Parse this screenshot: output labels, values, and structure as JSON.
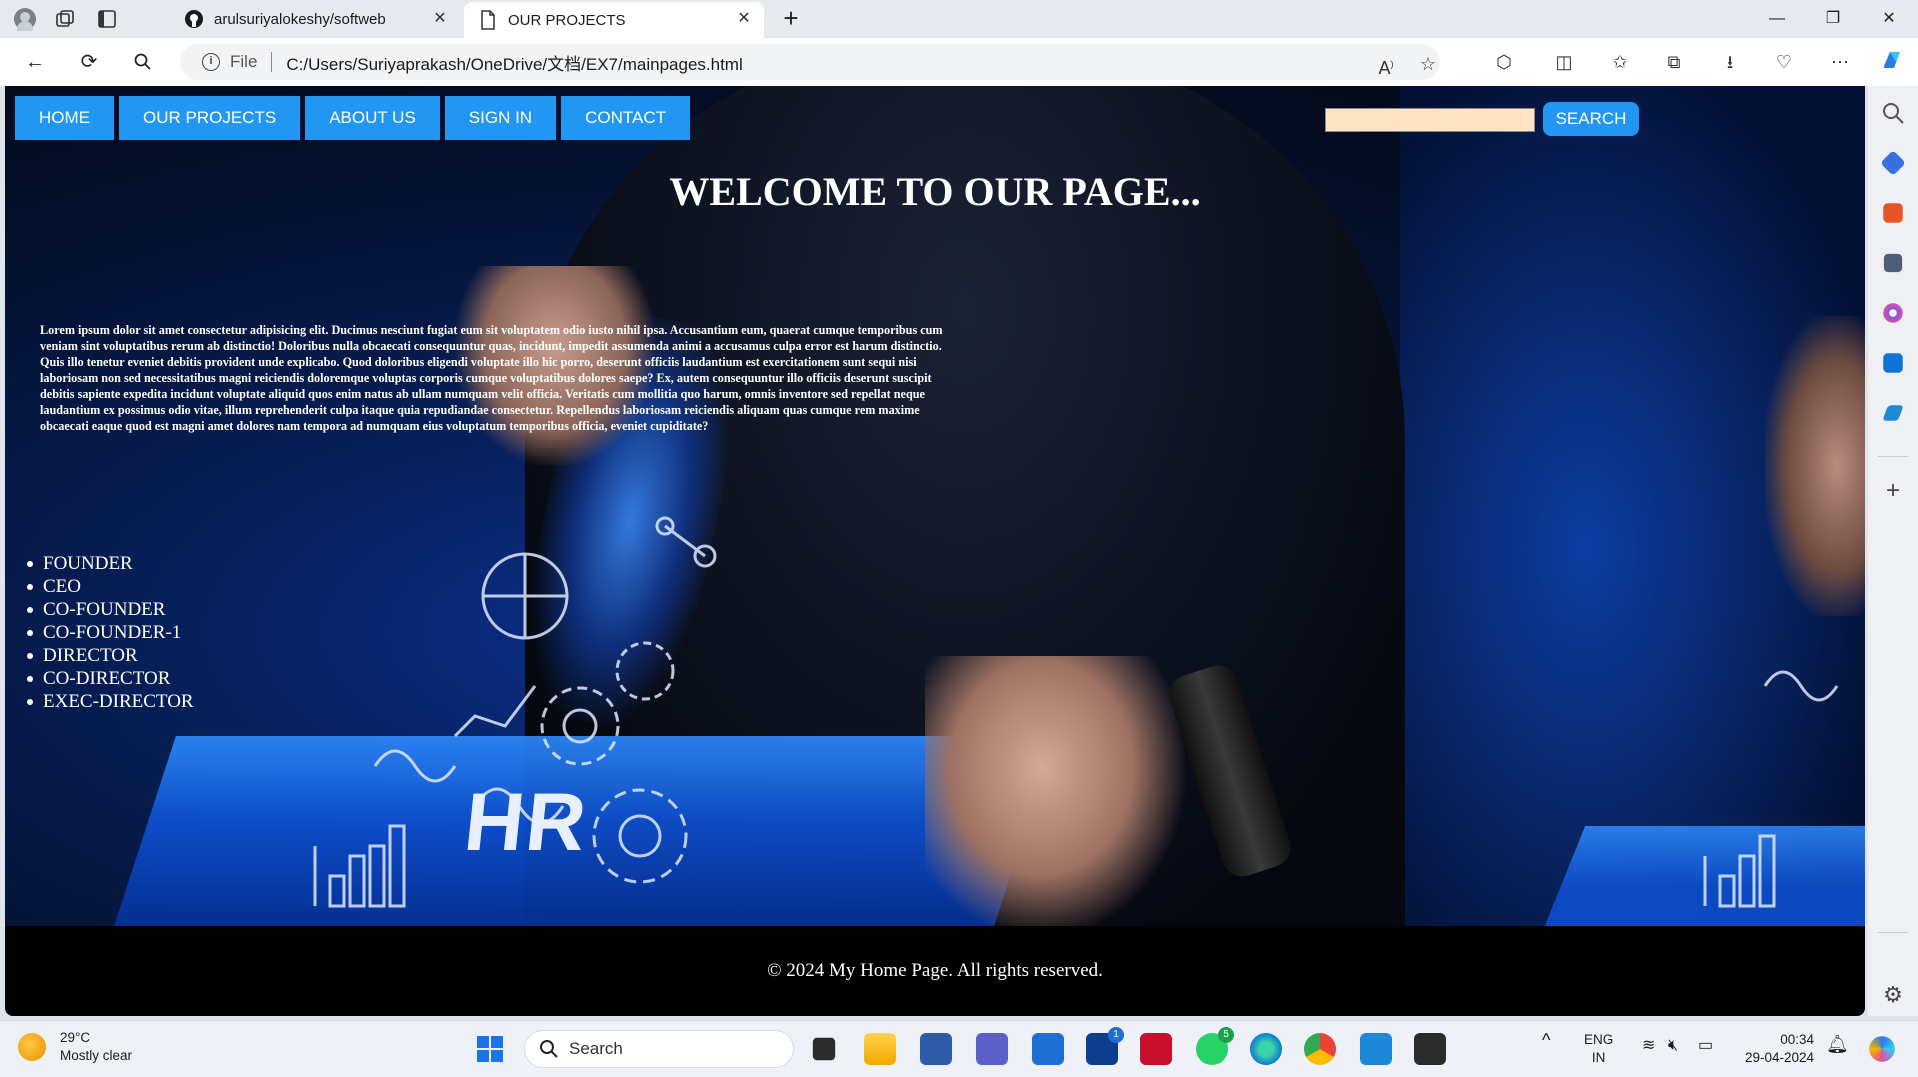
{
  "browser": {
    "tabs": [
      {
        "title": "arulsuriyalokeshy/softweb",
        "active": false
      },
      {
        "title": "OUR PROJECTS",
        "active": true
      }
    ],
    "address": {
      "scheme_label": "File",
      "url": "C:/Users/Suriyaprakash/OneDrive/文档/EX7/mainpages.html"
    },
    "window_controls": {
      "minimize": "—",
      "restore": "❐",
      "close": "✕"
    },
    "new_tab": "+"
  },
  "page": {
    "nav": {
      "items": [
        "HOME",
        "OUR PROJECTS",
        "ABOUT US",
        "SIGN IN",
        "CONTACT"
      ],
      "color": "#2196f3"
    },
    "search": {
      "value": "",
      "button": "SEARCH",
      "field_color": "#ffe4c4"
    },
    "heading": "WELCOME TO OUR PAGE...",
    "lorem": "Lorem ipsum dolor sit amet consectetur adipisicing elit. Ducimus nesciunt fugiat eum sit voluptatem odio iusto nihil ipsa. Accusantium eum, quaerat cumque temporibus cum veniam sint voluptatibus rerum ab distinctio! Doloribus nulla obcaecati consequuntur quas, incidunt, impedit assumenda animi a accusamus culpa error est harum distinctio. Quis illo tenetur eveniet debitis provident unde explicabo. Quod doloribus eligendi voluptate illo hic porro, deserunt officiis laudantium est exercitationem sunt sequi nisi laboriosam non sed necessitatibus magni reiciendis doloremque voluptas corporis cumque voluptatibus dolores saepe? Ex, autem consequuntur illo officiis deserunt suscipit debitis sapiente expedita incidunt voluptate aliquid quos enim natus ab ullam numquam velit officia. Veritatis cum mollitia quo harum, omnis inventore sed repellat neque laudantium ex possimus odio vitae, illum reprehenderit culpa itaque quia repudiandae consectetur. Repellendus laboriosam reiciendis aliquam quas cumque rem maxime obcaecati eaque quod est magni amet dolores nam tempora ad numquam eius voluptatum temporibus officia, eveniet cupiditate?",
    "roles": [
      "FOUNDER",
      "CEO",
      "CO-FOUNDER",
      "CO-FOUNDER-1",
      "DIRECTOR",
      "CO-DIRECTOR",
      "EXEC-DIRECTOR"
    ],
    "background_text": "HR",
    "footer": "© 2024 My Home Page. All rights reserved."
  },
  "taskbar": {
    "weather": {
      "temp": "29°C",
      "condition": "Mostly clear"
    },
    "search_label": "Search",
    "language": {
      "line1": "ENG",
      "line2": "IN"
    },
    "time": "00:34",
    "date": "29-04-2024",
    "badges": {
      "l_app": "1",
      "whatsapp": "5"
    }
  },
  "colors": {
    "accent": "#2196f3",
    "footer_bg": "#000000",
    "hero_blue": "#0e52d6"
  }
}
